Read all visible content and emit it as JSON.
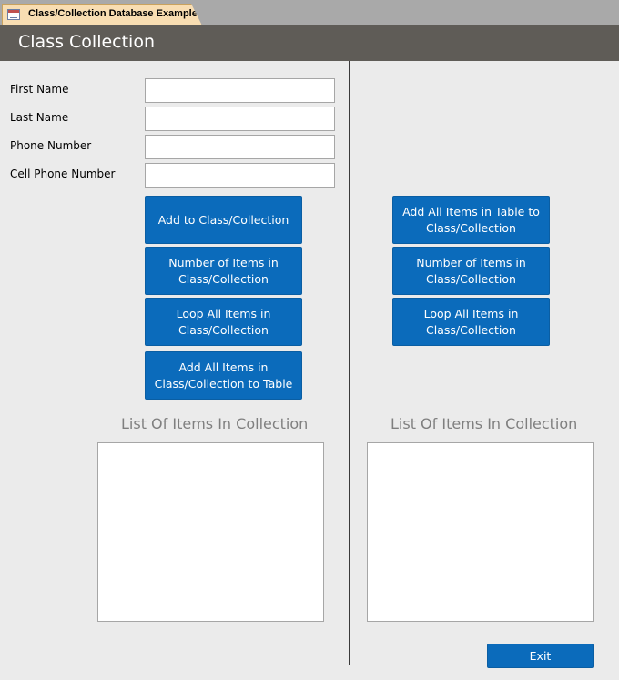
{
  "window": {
    "tab_label": "Class/Collection Database Example",
    "tab_icon": "form-icon"
  },
  "header": {
    "title": "Class Collection"
  },
  "form": {
    "fields": [
      {
        "label": "First Name",
        "value": ""
      },
      {
        "label": "Last Name",
        "value": ""
      },
      {
        "label": "Phone Number",
        "value": ""
      },
      {
        "label": "Cell Phone Number",
        "value": ""
      }
    ]
  },
  "left_panel": {
    "buttons": [
      {
        "label": "Add to Class/Collection"
      },
      {
        "label": "Number of Items in Class/Collection"
      },
      {
        "label": "Loop All Items in Class/Collection"
      },
      {
        "label": "Add All Items in Class/Collection to Table"
      }
    ],
    "list_title": "List Of Items In Collection"
  },
  "right_panel": {
    "buttons": [
      {
        "label": "Add All Items in Table to Class/Collection"
      },
      {
        "label": "Number of Items in Class/Collection"
      },
      {
        "label": "Loop All Items in Class/Collection"
      }
    ],
    "list_title": "List Of Items In Collection"
  },
  "footer": {
    "exit_label": "Exit"
  },
  "colors": {
    "button_blue": "#0b6bbb",
    "header_bg": "#5f5c57",
    "tab_bg": "#f8ddb2",
    "form_bg": "#ebebeb"
  }
}
